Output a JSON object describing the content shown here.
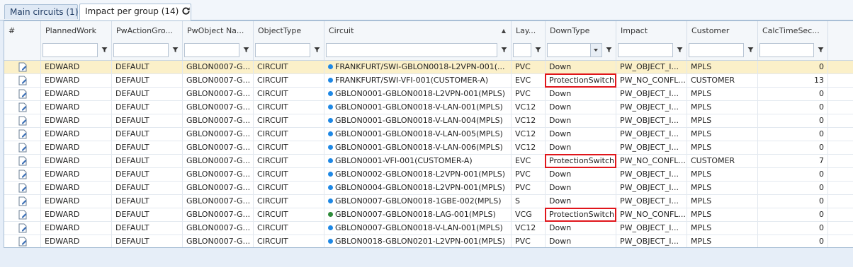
{
  "tabs": [
    {
      "label": "Main circuits (1)",
      "active": false
    },
    {
      "label": "Impact per group (14)",
      "active": true
    }
  ],
  "columns": [
    {
      "key": "idx",
      "label": "#"
    },
    {
      "key": "planned",
      "label": "PlannedWork"
    },
    {
      "key": "action",
      "label": "PwActionGro..."
    },
    {
      "key": "object",
      "label": "PwObject Na..."
    },
    {
      "key": "otype",
      "label": "ObjectType"
    },
    {
      "key": "circuit",
      "label": "Circuit",
      "sort": "asc"
    },
    {
      "key": "layer",
      "label": "Lay..."
    },
    {
      "key": "downtype",
      "label": "DownType"
    },
    {
      "key": "impact",
      "label": "Impact"
    },
    {
      "key": "customer",
      "label": "Customer"
    },
    {
      "key": "calc",
      "label": "CalcTimeSec..."
    }
  ],
  "colors": {
    "dot_blue": "#1e88e5",
    "dot_green": "#2e8b3a",
    "highlight_border": "#e0151b",
    "selected_row": "#fbf0c9"
  },
  "rows": [
    {
      "planned": "EDWARD",
      "action": "DEFAULT",
      "object": "GBLON0007-G...",
      "otype": "CIRCUIT",
      "dot": "blue",
      "circuit": "FRANKFURT/SWI-GBLON0018-L2VPN-001(...",
      "layer": "PVC",
      "downtype": "Down",
      "impact": "PW_OBJECT_I...",
      "customer": "MPLS",
      "calc": "0",
      "selected": true,
      "highlight": false
    },
    {
      "planned": "EDWARD",
      "action": "DEFAULT",
      "object": "GBLON0007-G...",
      "otype": "CIRCUIT",
      "dot": "blue",
      "circuit": "FRANKFURT/SWI-VFI-001(CUSTOMER-A)",
      "layer": "EVC",
      "downtype": "ProtectionSwitch",
      "impact": "PW_NO_CONFL...",
      "customer": "CUSTOMER",
      "calc": "13",
      "selected": false,
      "highlight": true
    },
    {
      "planned": "EDWARD",
      "action": "DEFAULT",
      "object": "GBLON0007-G...",
      "otype": "CIRCUIT",
      "dot": "blue",
      "circuit": "GBLON0001-GBLON0018-L2VPN-001(MPLS)",
      "layer": "PVC",
      "downtype": "Down",
      "impact": "PW_OBJECT_I...",
      "customer": "MPLS",
      "calc": "0",
      "selected": false,
      "highlight": false
    },
    {
      "planned": "EDWARD",
      "action": "DEFAULT",
      "object": "GBLON0007-G...",
      "otype": "CIRCUIT",
      "dot": "blue",
      "circuit": "GBLON0001-GBLON0018-V-LAN-001(MPLS)",
      "layer": "VC12",
      "downtype": "Down",
      "impact": "PW_OBJECT_I...",
      "customer": "MPLS",
      "calc": "0",
      "selected": false,
      "highlight": false
    },
    {
      "planned": "EDWARD",
      "action": "DEFAULT",
      "object": "GBLON0007-G...",
      "otype": "CIRCUIT",
      "dot": "blue",
      "circuit": "GBLON0001-GBLON0018-V-LAN-004(MPLS)",
      "layer": "VC12",
      "downtype": "Down",
      "impact": "PW_OBJECT_I...",
      "customer": "MPLS",
      "calc": "0",
      "selected": false,
      "highlight": false
    },
    {
      "planned": "EDWARD",
      "action": "DEFAULT",
      "object": "GBLON0007-G...",
      "otype": "CIRCUIT",
      "dot": "blue",
      "circuit": "GBLON0001-GBLON0018-V-LAN-005(MPLS)",
      "layer": "VC12",
      "downtype": "Down",
      "impact": "PW_OBJECT_I...",
      "customer": "MPLS",
      "calc": "0",
      "selected": false,
      "highlight": false
    },
    {
      "planned": "EDWARD",
      "action": "DEFAULT",
      "object": "GBLON0007-G...",
      "otype": "CIRCUIT",
      "dot": "blue",
      "circuit": "GBLON0001-GBLON0018-V-LAN-006(MPLS)",
      "layer": "VC12",
      "downtype": "Down",
      "impact": "PW_OBJECT_I...",
      "customer": "MPLS",
      "calc": "0",
      "selected": false,
      "highlight": false
    },
    {
      "planned": "EDWARD",
      "action": "DEFAULT",
      "object": "GBLON0007-G...",
      "otype": "CIRCUIT",
      "dot": "blue",
      "circuit": "GBLON0001-VFI-001(CUSTOMER-A)",
      "layer": "EVC",
      "downtype": "ProtectionSwitch",
      "impact": "PW_NO_CONFL...",
      "customer": "CUSTOMER",
      "calc": "7",
      "selected": false,
      "highlight": true
    },
    {
      "planned": "EDWARD",
      "action": "DEFAULT",
      "object": "GBLON0007-G...",
      "otype": "CIRCUIT",
      "dot": "blue",
      "circuit": "GBLON0002-GBLON0018-L2VPN-001(MPLS)",
      "layer": "PVC",
      "downtype": "Down",
      "impact": "PW_OBJECT_I...",
      "customer": "MPLS",
      "calc": "0",
      "selected": false,
      "highlight": false
    },
    {
      "planned": "EDWARD",
      "action": "DEFAULT",
      "object": "GBLON0007-G...",
      "otype": "CIRCUIT",
      "dot": "blue",
      "circuit": "GBLON0004-GBLON0018-L2VPN-001(MPLS)",
      "layer": "PVC",
      "downtype": "Down",
      "impact": "PW_OBJECT_I...",
      "customer": "MPLS",
      "calc": "0",
      "selected": false,
      "highlight": false
    },
    {
      "planned": "EDWARD",
      "action": "DEFAULT",
      "object": "GBLON0007-G...",
      "otype": "CIRCUIT",
      "dot": "blue",
      "circuit": "GBLON0007-GBLON0018-1GBE-002(MPLS)",
      "layer": "S",
      "downtype": "Down",
      "impact": "PW_OBJECT_I...",
      "customer": "MPLS",
      "calc": "0",
      "selected": false,
      "highlight": false
    },
    {
      "planned": "EDWARD",
      "action": "DEFAULT",
      "object": "GBLON0007-G...",
      "otype": "CIRCUIT",
      "dot": "green",
      "circuit": "GBLON0007-GBLON0018-LAG-001(MPLS)",
      "layer": "VCG",
      "downtype": "ProtectionSwitch",
      "impact": "PW_NO_CONFL...",
      "customer": "MPLS",
      "calc": "0",
      "selected": false,
      "highlight": true
    },
    {
      "planned": "EDWARD",
      "action": "DEFAULT",
      "object": "GBLON0007-G...",
      "otype": "CIRCUIT",
      "dot": "blue",
      "circuit": "GBLON0007-GBLON0018-V-LAN-001(MPLS)",
      "layer": "VC12",
      "downtype": "Down",
      "impact": "PW_OBJECT_I...",
      "customer": "MPLS",
      "calc": "0",
      "selected": false,
      "highlight": false
    },
    {
      "planned": "EDWARD",
      "action": "DEFAULT",
      "object": "GBLON0007-G...",
      "otype": "CIRCUIT",
      "dot": "blue",
      "circuit": "GBLON0018-GBLON0201-L2VPN-001(MPLS)",
      "layer": "PVC",
      "downtype": "Down",
      "impact": "PW_OBJECT_I...",
      "customer": "MPLS",
      "calc": "0",
      "selected": false,
      "highlight": false
    }
  ]
}
